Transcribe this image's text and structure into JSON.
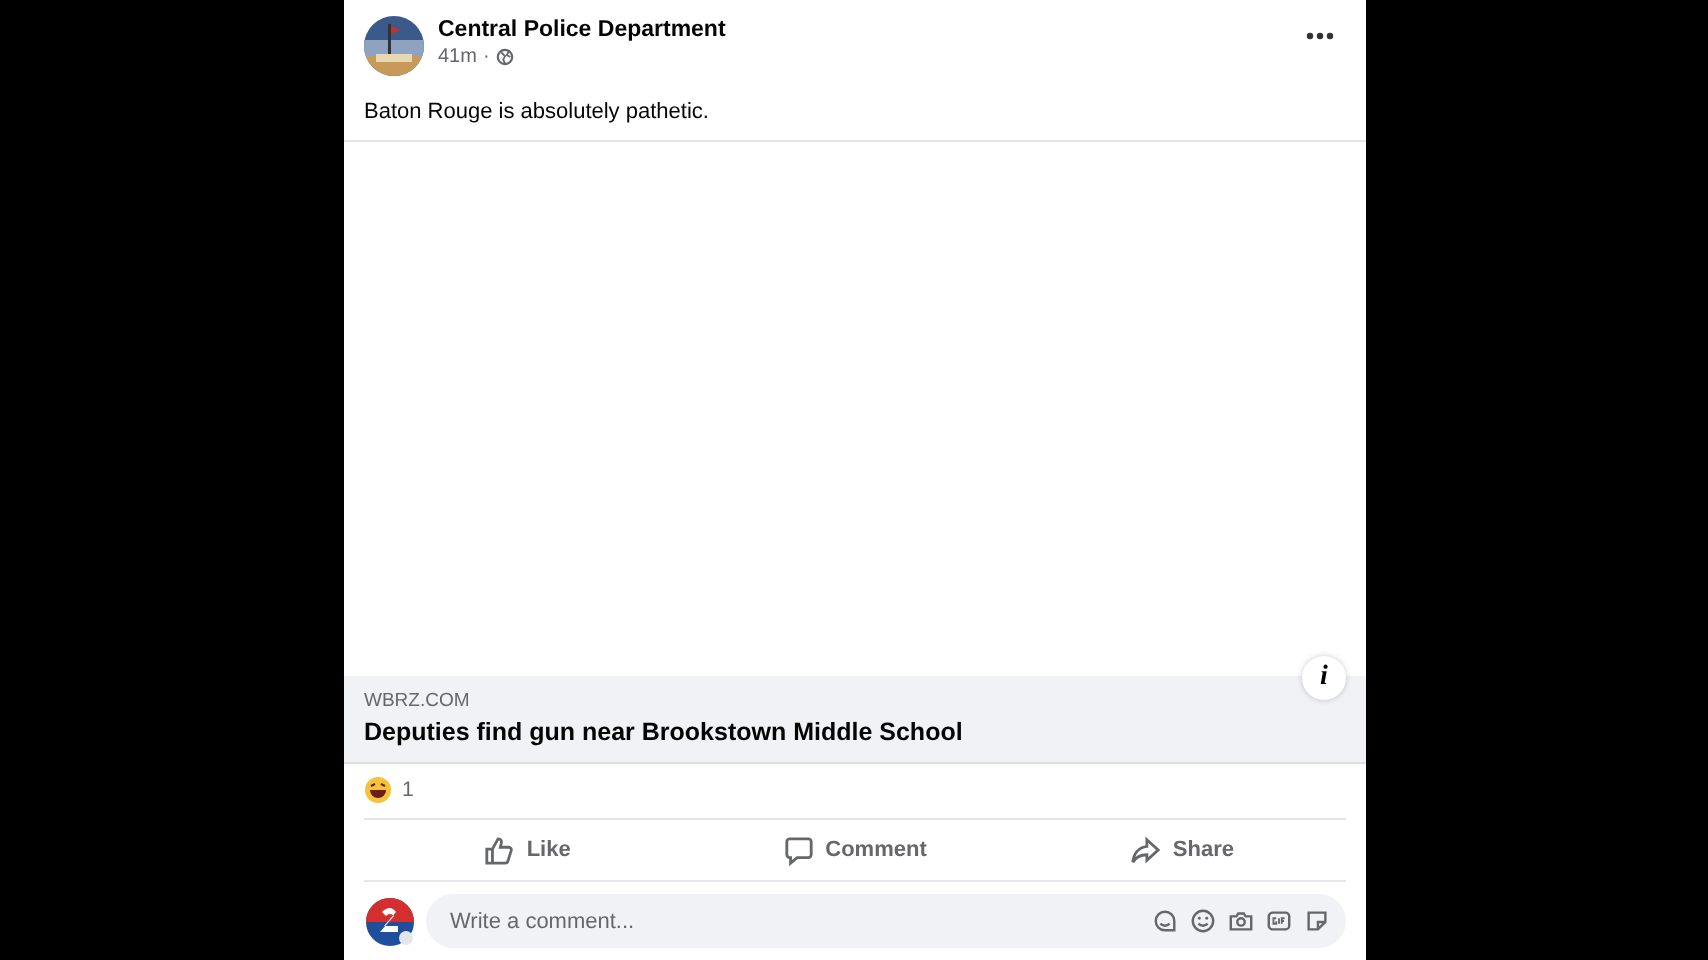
{
  "post": {
    "author": "Central Police Department",
    "time": "41m",
    "separator": "·",
    "text": "Baton Rouge is absolutely pathetic."
  },
  "link": {
    "domain": "WBRZ.COM",
    "title": "Deputies find gun near Brookstown Middle School",
    "info": "i"
  },
  "reactions": {
    "count": "1"
  },
  "actions": [
    {
      "kind": "like",
      "label": "Like"
    },
    {
      "kind": "comment",
      "label": "Comment"
    },
    {
      "kind": "share",
      "label": "Share"
    }
  ],
  "comment_box": {
    "placeholder": "Write a comment..."
  }
}
